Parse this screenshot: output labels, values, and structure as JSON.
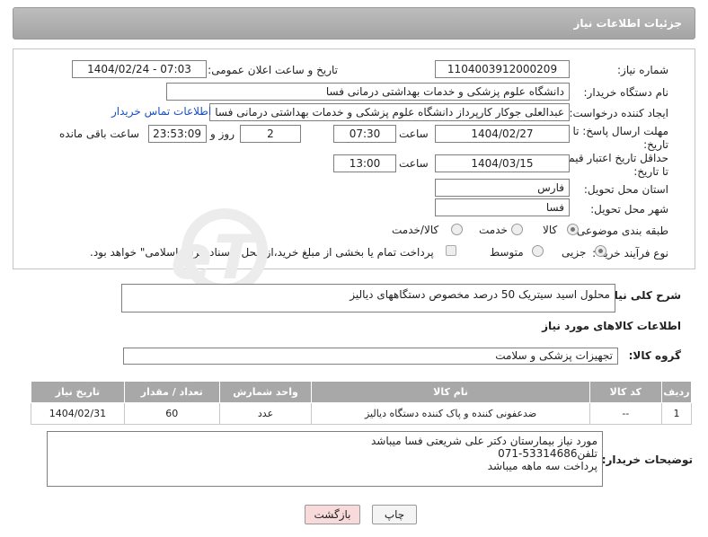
{
  "header": {
    "title": "جزئیات اطلاعات نیاز"
  },
  "form": {
    "need_number": {
      "label": "شماره نیاز:",
      "value": "1104003912000209"
    },
    "announce": {
      "label": "تاریخ و ساعت اعلان عمومی:",
      "value": "1404/02/24 - 07:03"
    },
    "buyer_org": {
      "label": "نام دستگاه خریدار:",
      "value": "دانشگاه علوم پزشکی و خدمات بهداشتی درمانی فسا"
    },
    "creator": {
      "label": "ایجاد کننده درخواست:",
      "value": "عبدالعلی جوکار کارپرداز دانشگاه علوم پزشکی و خدمات بهداشتی درمانی فسا",
      "contact_link": "اطلاعات تماس خریدار"
    },
    "reply_deadline": {
      "label_line1": "مهلت ارسال پاسخ: تا",
      "label_line2": "تاریخ:",
      "date": "1404/02/27",
      "time_label": "ساعت",
      "time": "07:30",
      "days": "2",
      "days_label": "روز و",
      "remaining": "23:53:09",
      "remaining_label": "ساعت باقی مانده"
    },
    "price_validity": {
      "label_line1": "حداقل تاریخ اعتبار قیمت:",
      "label_line2": "تا تاریخ:",
      "date": "1404/03/15",
      "time_label": "ساعت",
      "time": "13:00"
    },
    "province": {
      "label": "استان محل تحویل:",
      "value": "فارس"
    },
    "city": {
      "label": "شهر محل تحویل:",
      "value": "فسا"
    },
    "category": {
      "label": "طبقه بندی موضوعی:",
      "options": [
        "کالا",
        "خدمت",
        "کالا/خدمت"
      ],
      "selected": 0
    },
    "process": {
      "label": "نوع فرآیند خرید :",
      "options": [
        "جزیی",
        "متوسط"
      ],
      "selected": 0,
      "note": "پرداخت تمام یا بخشی از مبلغ خرید،از محل \"اسناد خزانه اسلامی\" خواهد بود."
    }
  },
  "description": {
    "label": "شرح کلی نیاز:",
    "value": "محلول اسید سیتریک 50 درصد مخصوص دستگاههای دیالیز"
  },
  "goods_section": {
    "title": "اطلاعات کالاهای مورد نیاز"
  },
  "goods_group": {
    "label": "گروه کالا:",
    "value": "تجهیزات پزشکی و سلامت"
  },
  "table": {
    "headers": [
      "ردیف",
      "کد کالا",
      "نام کالا",
      "واحد شمارش",
      "تعداد / مقدار",
      "تاریخ نیاز"
    ],
    "rows": [
      [
        "1",
        "--",
        "ضدعفونی کننده و پاک کننده دستگاه دیالیز",
        "عدد",
        "60",
        "1404/02/31"
      ]
    ]
  },
  "buyer_notes": {
    "label": "توضیحات خریدار:",
    "line1": "مورد نیاز بیمارستان دکتر علی شریعتی فسا میباشد",
    "line2": "تلفن53314686-071",
    "line3": "پرداخت سه ماهه میباشد"
  },
  "buttons": {
    "print": "چاپ",
    "back": "بازگشت"
  },
  "colors": {
    "header_bg": "#a8a8a8",
    "link": "#1a4fc4",
    "back_bg": "#f9dada"
  }
}
